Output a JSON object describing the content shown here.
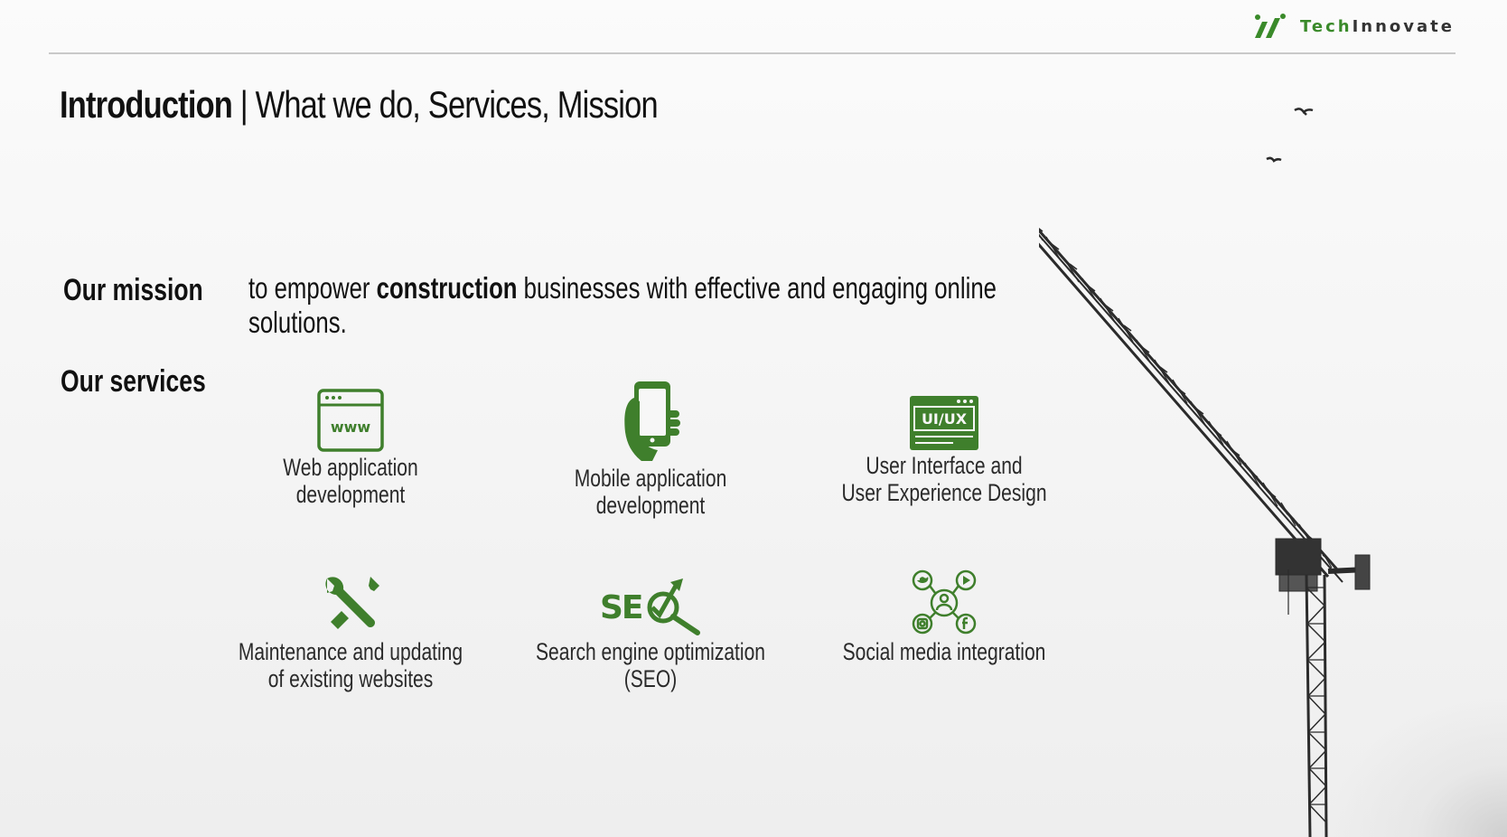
{
  "brand": {
    "name_part1": "Tech",
    "name_part2": "Innovate",
    "accent": "#3a8a2a"
  },
  "slide": {
    "title_bold": "Introduction",
    "title_rest": " | What we do, Services, Mission"
  },
  "mission": {
    "label": "Our mission",
    "text_before": "to empower ",
    "text_bold": "construction",
    "text_after": " businesses with effective and engaging online solutions."
  },
  "services": {
    "label": "Our services",
    "items": [
      {
        "icon": "browser-www-icon",
        "line1": "Web application",
        "line2": "development"
      },
      {
        "icon": "smartphone-hand-icon",
        "line1": "Mobile application",
        "line2": "development"
      },
      {
        "icon": "ui-ux-window-icon",
        "line1": "User Interface and",
        "line2": "User Experience Design"
      },
      {
        "icon": "wrench-screwdriver-icon",
        "line1": "Maintenance and updating",
        "line2": "of existing websites"
      },
      {
        "icon": "seo-icon",
        "line1": "Search engine optimization",
        "line2": "(SEO)"
      },
      {
        "icon": "social-network-icon",
        "line1": "Social media integration",
        "line2": ""
      }
    ]
  },
  "icon_text": {
    "www": "www",
    "uiux": "UI/UX",
    "seo": "SE"
  }
}
